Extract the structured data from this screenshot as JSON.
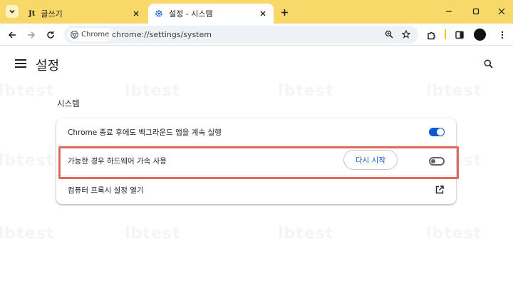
{
  "tabs": [
    {
      "label": "글쓰기",
      "favicon": "jt-icon",
      "active": false
    },
    {
      "label": "설정 - 시스템",
      "favicon": "gear-icon",
      "active": true
    }
  ],
  "omnibox": {
    "chip_label": "Chrome",
    "url": "chrome://settings/system"
  },
  "page": {
    "title": "설정",
    "section_title": "시스템",
    "rows": [
      {
        "label": "Chrome 종료 후에도 백그라운드 앱을 계속 실행",
        "control": "toggle",
        "state": "on"
      },
      {
        "label": "가능한 경우 하드웨어 가속 사용",
        "control": "toggle",
        "state": "off",
        "button_label": "다시 시작"
      },
      {
        "label": "컴퓨터 프록시 설정 열기",
        "control": "external-link"
      }
    ]
  },
  "watermark": "lbtest",
  "colors": {
    "tab_strip": "#f9d86a",
    "accent": "#0b57d0",
    "highlight": "#e0685d"
  }
}
